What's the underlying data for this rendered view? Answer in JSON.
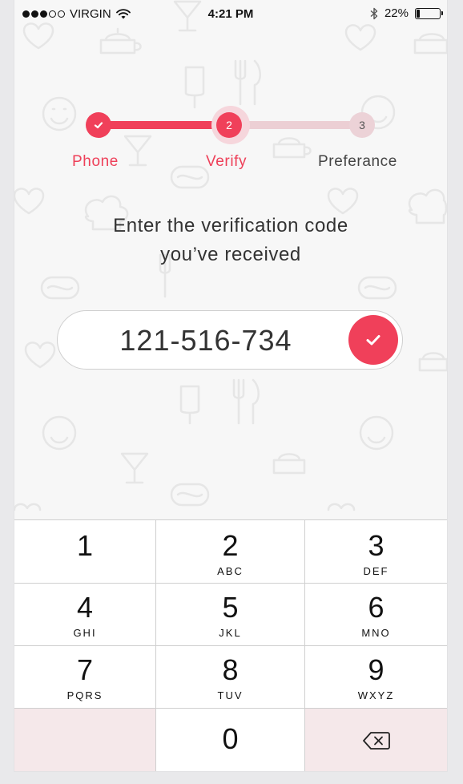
{
  "status_bar": {
    "carrier": "VIRGIN",
    "time": "4:21 PM",
    "battery": "22%",
    "battery_level": 0.22
  },
  "stepper": {
    "steps": [
      {
        "number": "1",
        "label": "Phone",
        "state": "done"
      },
      {
        "number": "2",
        "label": "Verify",
        "state": "active"
      },
      {
        "number": "3",
        "label": "Preferance",
        "state": "todo"
      }
    ]
  },
  "heading": {
    "line1": "Enter the verification code",
    "line2": "you’ve received"
  },
  "code_input": {
    "value": "121-516-734"
  },
  "keypad": {
    "keys": [
      {
        "num": "1",
        "letters": ""
      },
      {
        "num": "2",
        "letters": "ABC"
      },
      {
        "num": "3",
        "letters": "DEF"
      },
      {
        "num": "4",
        "letters": "GHI"
      },
      {
        "num": "5",
        "letters": "JKL"
      },
      {
        "num": "6",
        "letters": "MNO"
      },
      {
        "num": "7",
        "letters": "PQRS"
      },
      {
        "num": "8",
        "letters": "TUV"
      },
      {
        "num": "9",
        "letters": "WXYZ"
      },
      {
        "num": "0",
        "letters": ""
      }
    ]
  },
  "colors": {
    "accent": "#f0405a",
    "track_inactive": "#eccfd4",
    "key_special_bg": "#f5e8ea"
  },
  "icons": {
    "wifi": "wifi-icon",
    "bluetooth": "bluetooth-icon",
    "battery": "battery-icon",
    "step_done": "check-icon",
    "confirm": "check-icon",
    "delete": "backspace-icon"
  }
}
